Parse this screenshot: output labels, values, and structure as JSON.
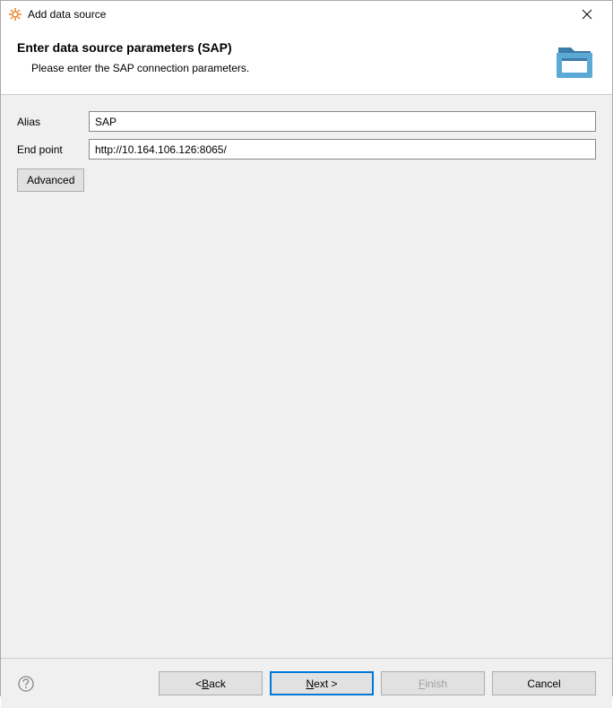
{
  "titlebar": {
    "title": "Add data source"
  },
  "header": {
    "title": "Enter data source parameters (SAP)",
    "subtitle": "Please enter the SAP connection parameters."
  },
  "form": {
    "alias_label": "Alias",
    "alias_value": "SAP",
    "endpoint_label": "End point",
    "endpoint_value": "http://10.164.106.126:8065/",
    "advanced_label": "Advanced"
  },
  "footer": {
    "back_prefix": "< ",
    "back_m": "B",
    "back_rest": "ack",
    "next_m": "N",
    "next_rest": "ext >",
    "finish_m": "F",
    "finish_rest": "inish",
    "cancel": "Cancel"
  }
}
